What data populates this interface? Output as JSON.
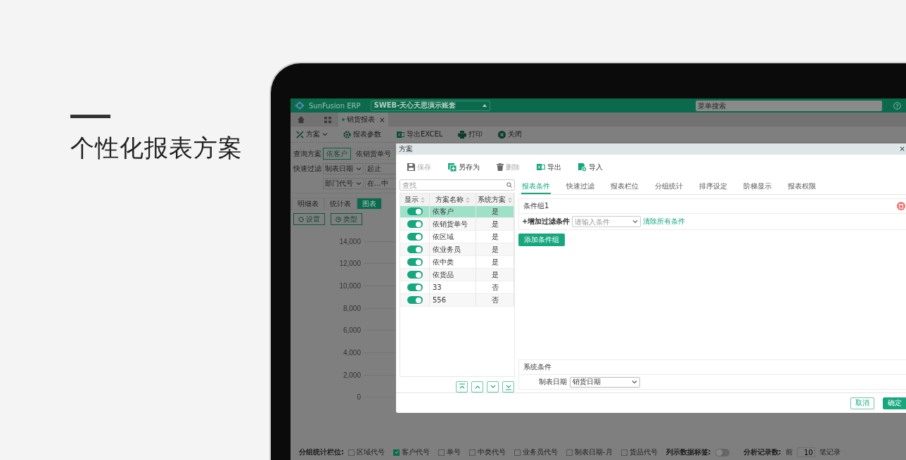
{
  "hero": {
    "title": "个性化报表方案"
  },
  "app": {
    "brand": "SunFusion ERP",
    "account": "SWEB-天心天思演示账套",
    "menu_search": {
      "placeholder": "菜单搜索"
    },
    "tabs": [
      {
        "label": "销货报表",
        "selected": true,
        "close": "×"
      }
    ],
    "toolbar": [
      {
        "label": "方案",
        "kind": "scheme"
      },
      {
        "label": "报表参数",
        "kind": "params"
      },
      {
        "label": "导出EXCEL",
        "kind": "excel"
      },
      {
        "label": "打印",
        "kind": "print"
      },
      {
        "label": "关闭",
        "kind": "close"
      }
    ],
    "query": {
      "label": "查询方案",
      "options": [
        {
          "label": "依客户",
          "selected": true
        },
        {
          "label": "依销货单号",
          "selected": false
        }
      ]
    },
    "quick_filter": {
      "label": "快速过滤",
      "rows": [
        {
          "field": "制表日期",
          "operator": "起止"
        },
        {
          "field": "部门代号",
          "operator": "在...中"
        }
      ]
    },
    "view_tabs": [
      {
        "label": "明细表",
        "selected": false
      },
      {
        "label": "统计表",
        "selected": false
      },
      {
        "label": "图表",
        "selected": true
      }
    ],
    "chart_buttons": [
      {
        "label": "设置",
        "kind": "settings"
      },
      {
        "label": "类型",
        "kind": "type"
      }
    ],
    "chart": {
      "y_labels": [
        "14,000",
        "12,000",
        "10,000",
        "8,000",
        "6,000",
        "4,000",
        "2,000",
        "0"
      ]
    },
    "bottom": {
      "group_label": "分组统计栏位:",
      "group_fields": [
        {
          "label": "区域代号",
          "checked": false
        },
        {
          "label": "客户代号",
          "checked": true
        },
        {
          "label": "单号",
          "checked": false
        },
        {
          "label": "中类代号",
          "checked": false
        },
        {
          "label": "业务员代号",
          "checked": false
        },
        {
          "label": "制表日期-月",
          "checked": false
        },
        {
          "label": "货品代号",
          "checked": false
        }
      ],
      "data_label": {
        "label": "列示数据标签:",
        "on": false
      },
      "records": {
        "label": "分析记录数:",
        "prefix": "前",
        "value": "10",
        "suffix": "笔记录"
      }
    }
  },
  "dialog": {
    "title": "方案",
    "close": "×",
    "toolbar": [
      {
        "label": "保存",
        "kind": "save",
        "disabled": true
      },
      {
        "label": "另存为",
        "kind": "save_as",
        "disabled": false
      },
      {
        "label": "删除",
        "kind": "delete",
        "disabled": true
      },
      {
        "label": "导出",
        "kind": "export",
        "disabled": false
      },
      {
        "label": "导入",
        "kind": "import",
        "disabled": false
      }
    ],
    "search": {
      "placeholder": "查找"
    },
    "columns": [
      "显示",
      "方案名称",
      "系统方案"
    ],
    "rows": [
      {
        "shown": true,
        "name": "依客户",
        "system": "是",
        "selected": true
      },
      {
        "shown": true,
        "name": "依销货单号",
        "system": "是",
        "selected": false
      },
      {
        "shown": true,
        "name": "依区域",
        "system": "是",
        "selected": false
      },
      {
        "shown": true,
        "name": "依业务员",
        "system": "是",
        "selected": false
      },
      {
        "shown": true,
        "name": "依中类",
        "system": "是",
        "selected": false
      },
      {
        "shown": true,
        "name": "依货品",
        "system": "是",
        "selected": false
      },
      {
        "shown": true,
        "name": "33",
        "system": "否",
        "selected": false
      },
      {
        "shown": true,
        "name": "556",
        "system": "否",
        "selected": false
      }
    ],
    "tabs": [
      {
        "label": "报表条件",
        "selected": true
      },
      {
        "label": "快速过滤",
        "selected": false
      },
      {
        "label": "报表栏位",
        "selected": false
      },
      {
        "label": "分组统计",
        "selected": false
      },
      {
        "label": "排序设定",
        "selected": false
      },
      {
        "label": "阶梯显示",
        "selected": false
      },
      {
        "label": "报表权限",
        "selected": false
      }
    ],
    "condition_group": {
      "title": "条件组1",
      "add_label": "+增加过滤条件",
      "placeholder": "请输入条件",
      "clear": "清除所有条件"
    },
    "add_group": "添加条件组",
    "system_conditions": {
      "title": "系统条件",
      "field": "制表日期",
      "value": "销货日期"
    },
    "buttons": [
      {
        "label": "取消",
        "kind": "secondary"
      },
      {
        "label": "确定",
        "kind": "primary"
      }
    ]
  }
}
